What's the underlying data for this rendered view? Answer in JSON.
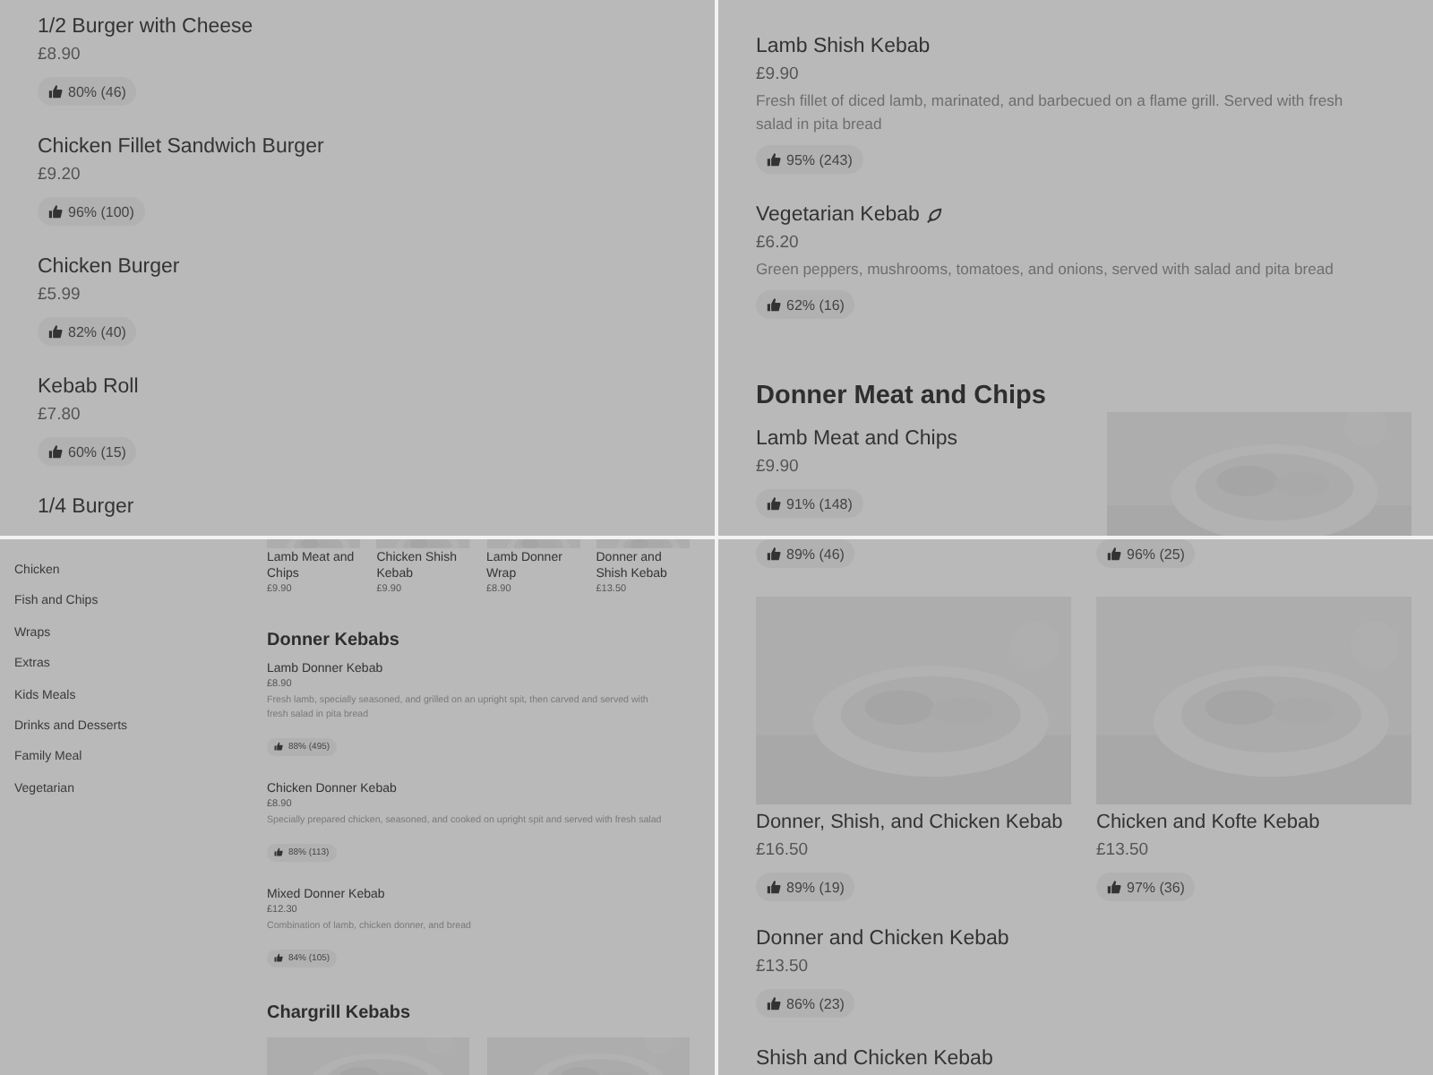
{
  "panels": [
    {
      "kind": "wide",
      "blocks": [
        {
          "kind": "item",
          "name": "1/2 Burger with Cheese",
          "price": "£8.90",
          "rating": "80% (46)"
        },
        {
          "kind": "item",
          "name": "Chicken Fillet Sandwich Burger",
          "price": "£9.20",
          "rating": "96% (100)"
        },
        {
          "kind": "item",
          "name": "Chicken Burger",
          "price": "£5.99",
          "rating": "82% (40)"
        },
        {
          "kind": "item",
          "name": "Kebab Roll",
          "price": "£7.80",
          "rating": "60% (15)"
        },
        {
          "kind": "item",
          "name": "1/4 Burger"
        }
      ]
    },
    {
      "kind": "wide",
      "blocks": [
        {
          "kind": "item",
          "name": "Lamb Shish Kebab",
          "price": "£9.90",
          "description": "Fresh fillet of diced lamb, marinated, and barbecued on a flame grill. Served with fresh salad in pita bread",
          "rating": "95% (243)"
        },
        {
          "kind": "item",
          "name": "Vegetarian Kebab",
          "vegetarian": true,
          "price": "£6.20",
          "description": "Green peppers, mushrooms, tomatoes, and onions, served with salad and pita bread",
          "rating": "62% (16)"
        },
        {
          "kind": "heading",
          "text": "Donner Meat and Chips"
        },
        {
          "kind": "item",
          "name": "Lamb Meat and Chips",
          "price": "£9.90",
          "rating": "91% (148)",
          "picture": true
        }
      ]
    },
    {
      "kind": "compact",
      "sidebar": [
        "Chicken",
        "Fish and Chips",
        "Wraps",
        "Extras",
        "Kids Meals",
        "Drinks and Desserts",
        "Family Meal",
        "Vegetarian"
      ],
      "blocks": [
        {
          "kind": "cards",
          "cards": [
            {
              "name": "Lamb Meat and Chips",
              "price": "£9.90"
            },
            {
              "name": "Chicken Shish Kebab",
              "price": "£9.90"
            },
            {
              "name": "Lamb Donner Wrap",
              "price": "£8.90"
            },
            {
              "name": "Donner and Shish Kebab",
              "price": "£13.50"
            }
          ]
        },
        {
          "kind": "heading",
          "text": "Donner Kebabs"
        },
        {
          "kind": "item",
          "name": "Lamb Donner Kebab",
          "price": "£8.90",
          "description": "Fresh lamb, specially seasoned, and grilled on an upright spit, then carved and served with fresh salad in pita bread",
          "rating": "88% (495)"
        },
        {
          "kind": "item",
          "name": "Chicken Donner Kebab",
          "price": "£8.90",
          "description": "Specially prepared chicken, seasoned, and cooked on upright spit and served with fresh salad",
          "rating": "88% (113)"
        },
        {
          "kind": "item",
          "name": "Mixed Donner Kebab",
          "price": "£12.30",
          "description": "Combination of lamb, chicken donner, and bread",
          "rating": "84% (105)"
        },
        {
          "kind": "heading",
          "text": "Chargrill Kebabs"
        },
        {
          "kind": "pictures"
        }
      ]
    },
    {
      "kind": "wide",
      "blocks": [
        {
          "kind": "ratings",
          "ratings": [
            "89% (46)",
            "96% (25)"
          ]
        },
        {
          "kind": "cards",
          "cards": [
            {
              "name": "Donner, Shish, and Chicken Kebab",
              "price": "£16.50",
              "rating": "89% (19)"
            },
            {
              "name": "Chicken and Kofte Kebab",
              "price": "£13.50",
              "rating": "97% (36)"
            }
          ]
        },
        {
          "kind": "item",
          "name": "Donner and Chicken Kebab",
          "price": "£13.50",
          "rating": "86% (23)"
        },
        {
          "kind": "item",
          "name": "Shish and Chicken Kebab"
        }
      ]
    }
  ]
}
